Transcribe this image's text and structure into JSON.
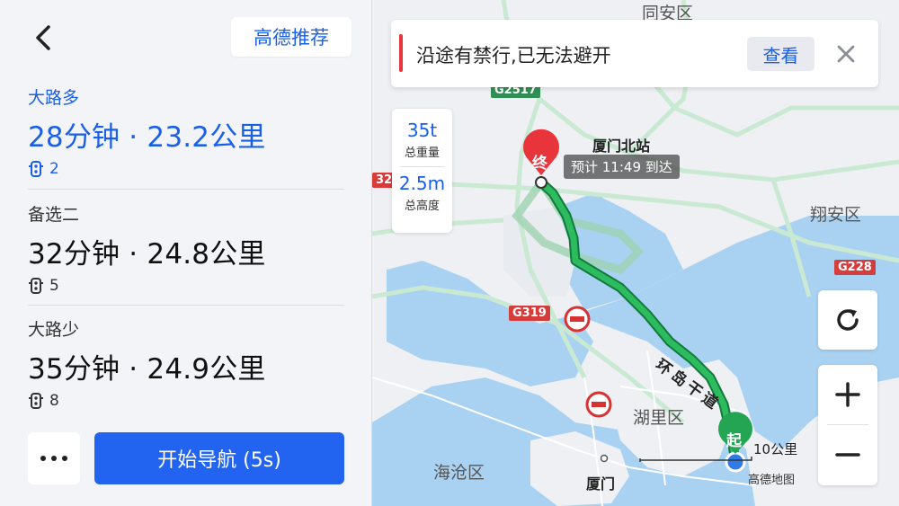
{
  "header": {
    "recommend_label": "高德推荐"
  },
  "routes": [
    {
      "tag": "大路多",
      "summary": "28分钟 · 23.2公里",
      "lights": "2",
      "active": true
    },
    {
      "tag": "备选二",
      "summary": "32分钟 · 24.8公里",
      "lights": "5",
      "active": false
    },
    {
      "tag": "大路少",
      "summary": "35分钟 · 24.9公里",
      "lights": "8",
      "active": false
    }
  ],
  "actions": {
    "more_label": "···",
    "start_label": "开始导航 (5s)"
  },
  "alert": {
    "message": "沿途有禁行,已无法避开",
    "view_label": "查看"
  },
  "vehicle": {
    "weight_value": "35t",
    "weight_label": "总重量",
    "height_value": "2.5m",
    "height_label": "总高度"
  },
  "map": {
    "districts": {
      "tongan": "同安区",
      "xiangan": "翔安区",
      "huli": "湖里区",
      "haicang": "海沧区"
    },
    "destination": {
      "name": "厦门北站",
      "eta": "预计 11:49 到达",
      "marker": "终"
    },
    "origin_marker": "起",
    "city": "厦门",
    "road_name": "环岛干道",
    "road_badges": {
      "g2517": "G2517",
      "g324": "324",
      "g228": "G228",
      "g319": "G319"
    },
    "scale": "10公里",
    "logo": "高德地图"
  },
  "colors": {
    "accent": "#1a5fe8",
    "start_button": "#2263f0",
    "alert_red": "#e8353b",
    "route_green": "#1f9d4c",
    "water": "#a9d2f2"
  }
}
